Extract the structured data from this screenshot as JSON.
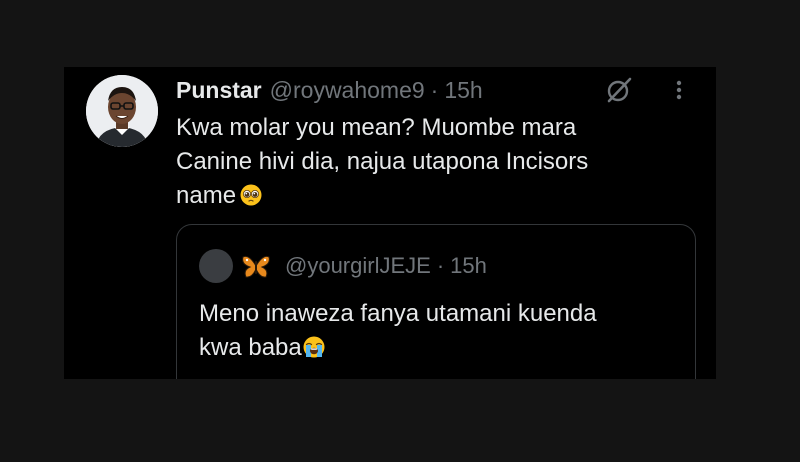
{
  "tweet": {
    "display_name": "Punstar",
    "handle": "@roywahome9",
    "separator": "·",
    "time": "15h",
    "text_lines": [
      "Kwa molar you mean? Muombe mara",
      "Canine hivi dia, najua utapona Incisors",
      "name"
    ],
    "text_emoji": "pleading-face-emoji",
    "icons": {
      "grok": "grok-icon",
      "more": "more-icon"
    }
  },
  "quoted_tweet": {
    "handle": "@yourgirlJEJE",
    "separator": "·",
    "time": "15h",
    "name_emoji": "butterfly-icon",
    "text_lines": [
      "Meno inaweza fanya utamani kuenda",
      "kwa baba"
    ],
    "text_emoji": "loudly-crying-face-emoji"
  },
  "colors": {
    "background": "#000000",
    "page": "#141414",
    "primary_text": "#e7e9ea",
    "secondary_text": "#71767b",
    "border": "#333639"
  }
}
